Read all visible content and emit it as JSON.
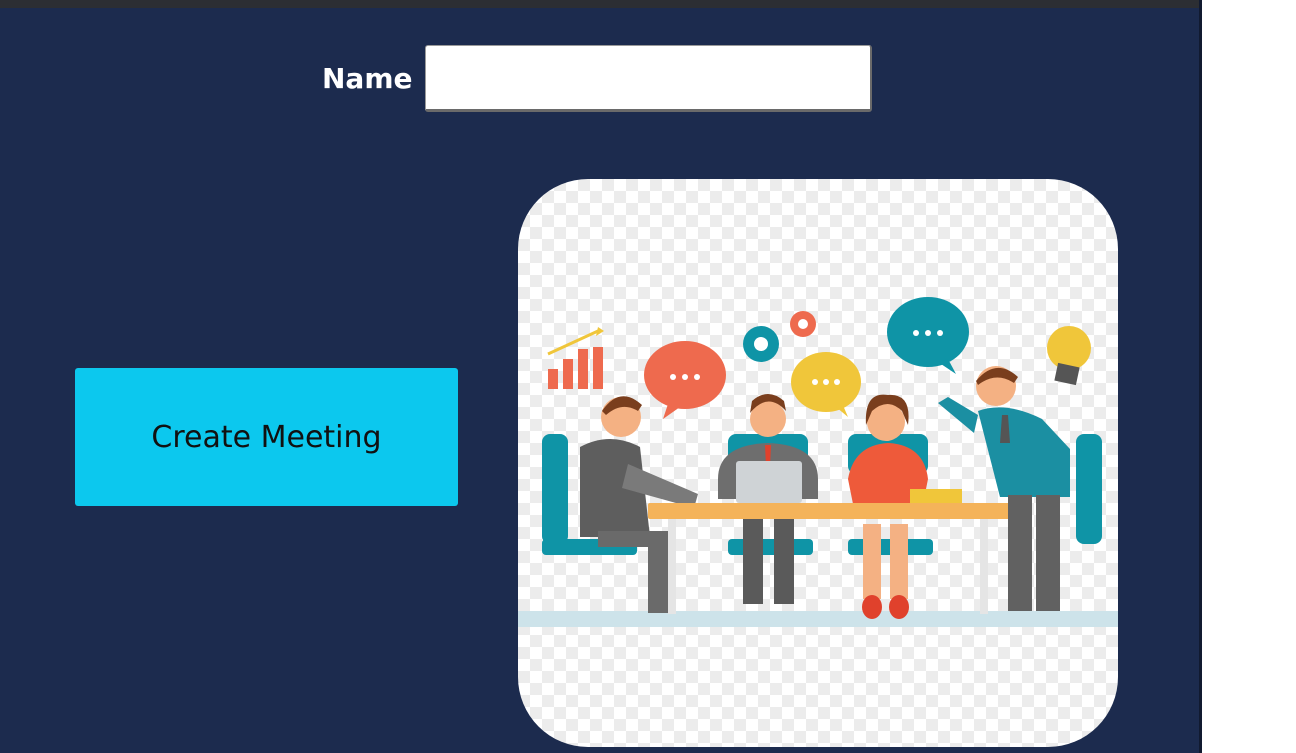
{
  "form": {
    "name_label": "Name",
    "name_value": "",
    "name_placeholder": ""
  },
  "actions": {
    "create_meeting_label": "Create Meeting"
  },
  "illustration": {
    "subject": "team meeting around a table"
  },
  "colors": {
    "background": "#1c2b4e",
    "button": "#0cc8ee",
    "input": "#ffffff"
  }
}
